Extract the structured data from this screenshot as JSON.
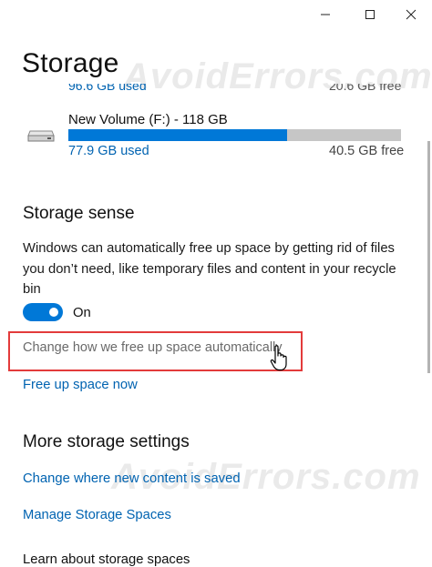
{
  "window": {
    "title": "Storage",
    "controls": {
      "minimize": "minimize-icon",
      "maximize": "maximize-icon",
      "close": "close-icon"
    }
  },
  "partial_drive_above": {
    "used": "96.6 GB used",
    "free": "20.6 GB free"
  },
  "drive": {
    "name": "New Volume (F:) - 118 GB",
    "used": "77.9 GB used",
    "free": "40.5 GB free",
    "used_fraction": 0.658,
    "icon": "drive-icon"
  },
  "storage_sense": {
    "heading": "Storage sense",
    "description": "Windows can automatically free up space by getting rid of files you don’t need, like temporary files and content in your recycle bin",
    "toggle_state": "On",
    "change_link": "Change how we free up space automatically",
    "free_now_link": "Free up space now"
  },
  "more_settings": {
    "heading": "More storage settings",
    "change_where_link": "Change where new content is saved",
    "manage_spaces_link": "Manage Storage Spaces",
    "cut_off_text": "Learn about storage spaces"
  },
  "watermark": "AvoidErrors.com",
  "colors": {
    "accent": "#0078d7",
    "link": "#0063b1",
    "highlight": "#e33b3b"
  }
}
